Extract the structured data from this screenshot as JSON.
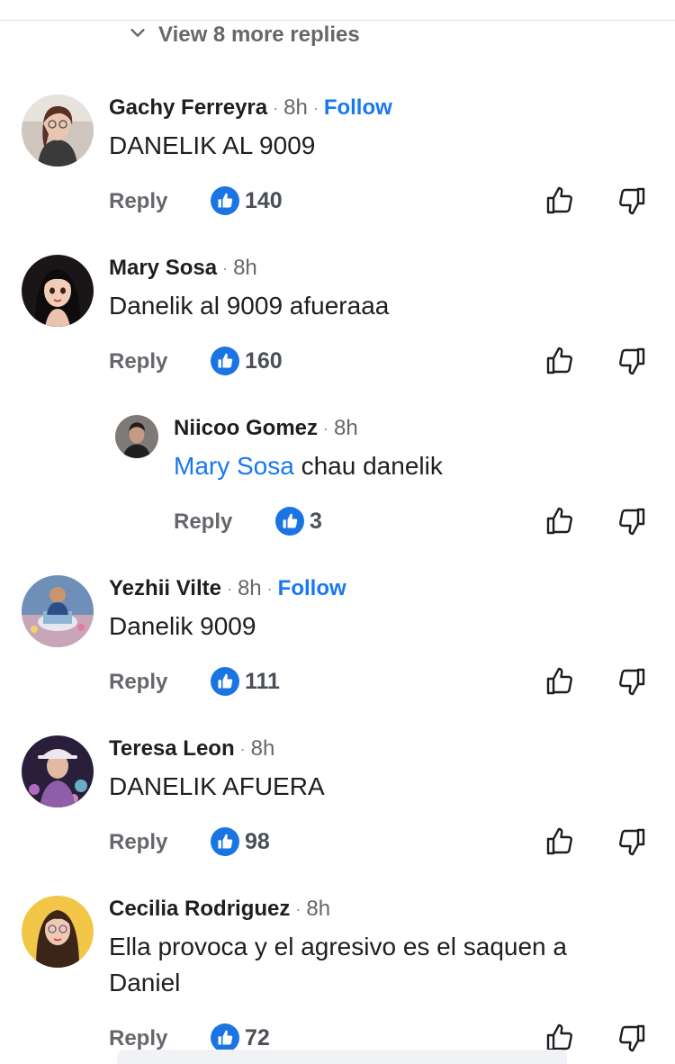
{
  "thread": {
    "view_more": "View 8 more replies",
    "reply_label": "Reply",
    "follow_label": "Follow",
    "separator": "·"
  },
  "comments": [
    {
      "name": "Gachy Ferreyra",
      "time": "8h",
      "follow": true,
      "text": [
        "DANELIK AL 9009"
      ],
      "likes": "140"
    },
    {
      "name": "Mary Sosa",
      "time": "8h",
      "follow": false,
      "text": [
        "Danelik al 9009 afueraaa"
      ],
      "likes": "160"
    },
    {
      "name": "Niicoo Gomez",
      "time": "8h",
      "follow": false,
      "mention": "Mary Sosa",
      "text": [
        " chau danelik"
      ],
      "likes": "3"
    },
    {
      "name": "Yezhii Vilte",
      "time": "8h",
      "follow": true,
      "text": [
        "Danelik 9009"
      ],
      "likes": "111"
    },
    {
      "name": "Teresa Leon",
      "time": "8h",
      "follow": false,
      "text": [
        "DANELIK AFUERA"
      ],
      "likes": "98"
    },
    {
      "name": "Cecilia Rodriguez",
      "time": "8h",
      "follow": false,
      "text": [
        "Ella provoca y el agresivo es el saquen a",
        "Daniel"
      ],
      "likes": "72"
    }
  ],
  "icons": {
    "chevron": "chevron-down-icon",
    "like": "thumbs-up-icon",
    "upvote": "thumbs-up-outline-icon",
    "downvote": "thumbs-down-outline-icon"
  },
  "colors": {
    "accent": "#1877f2",
    "like_bubble": "#1b74e4",
    "muted": "#65676b",
    "text": "#1c1e21"
  }
}
